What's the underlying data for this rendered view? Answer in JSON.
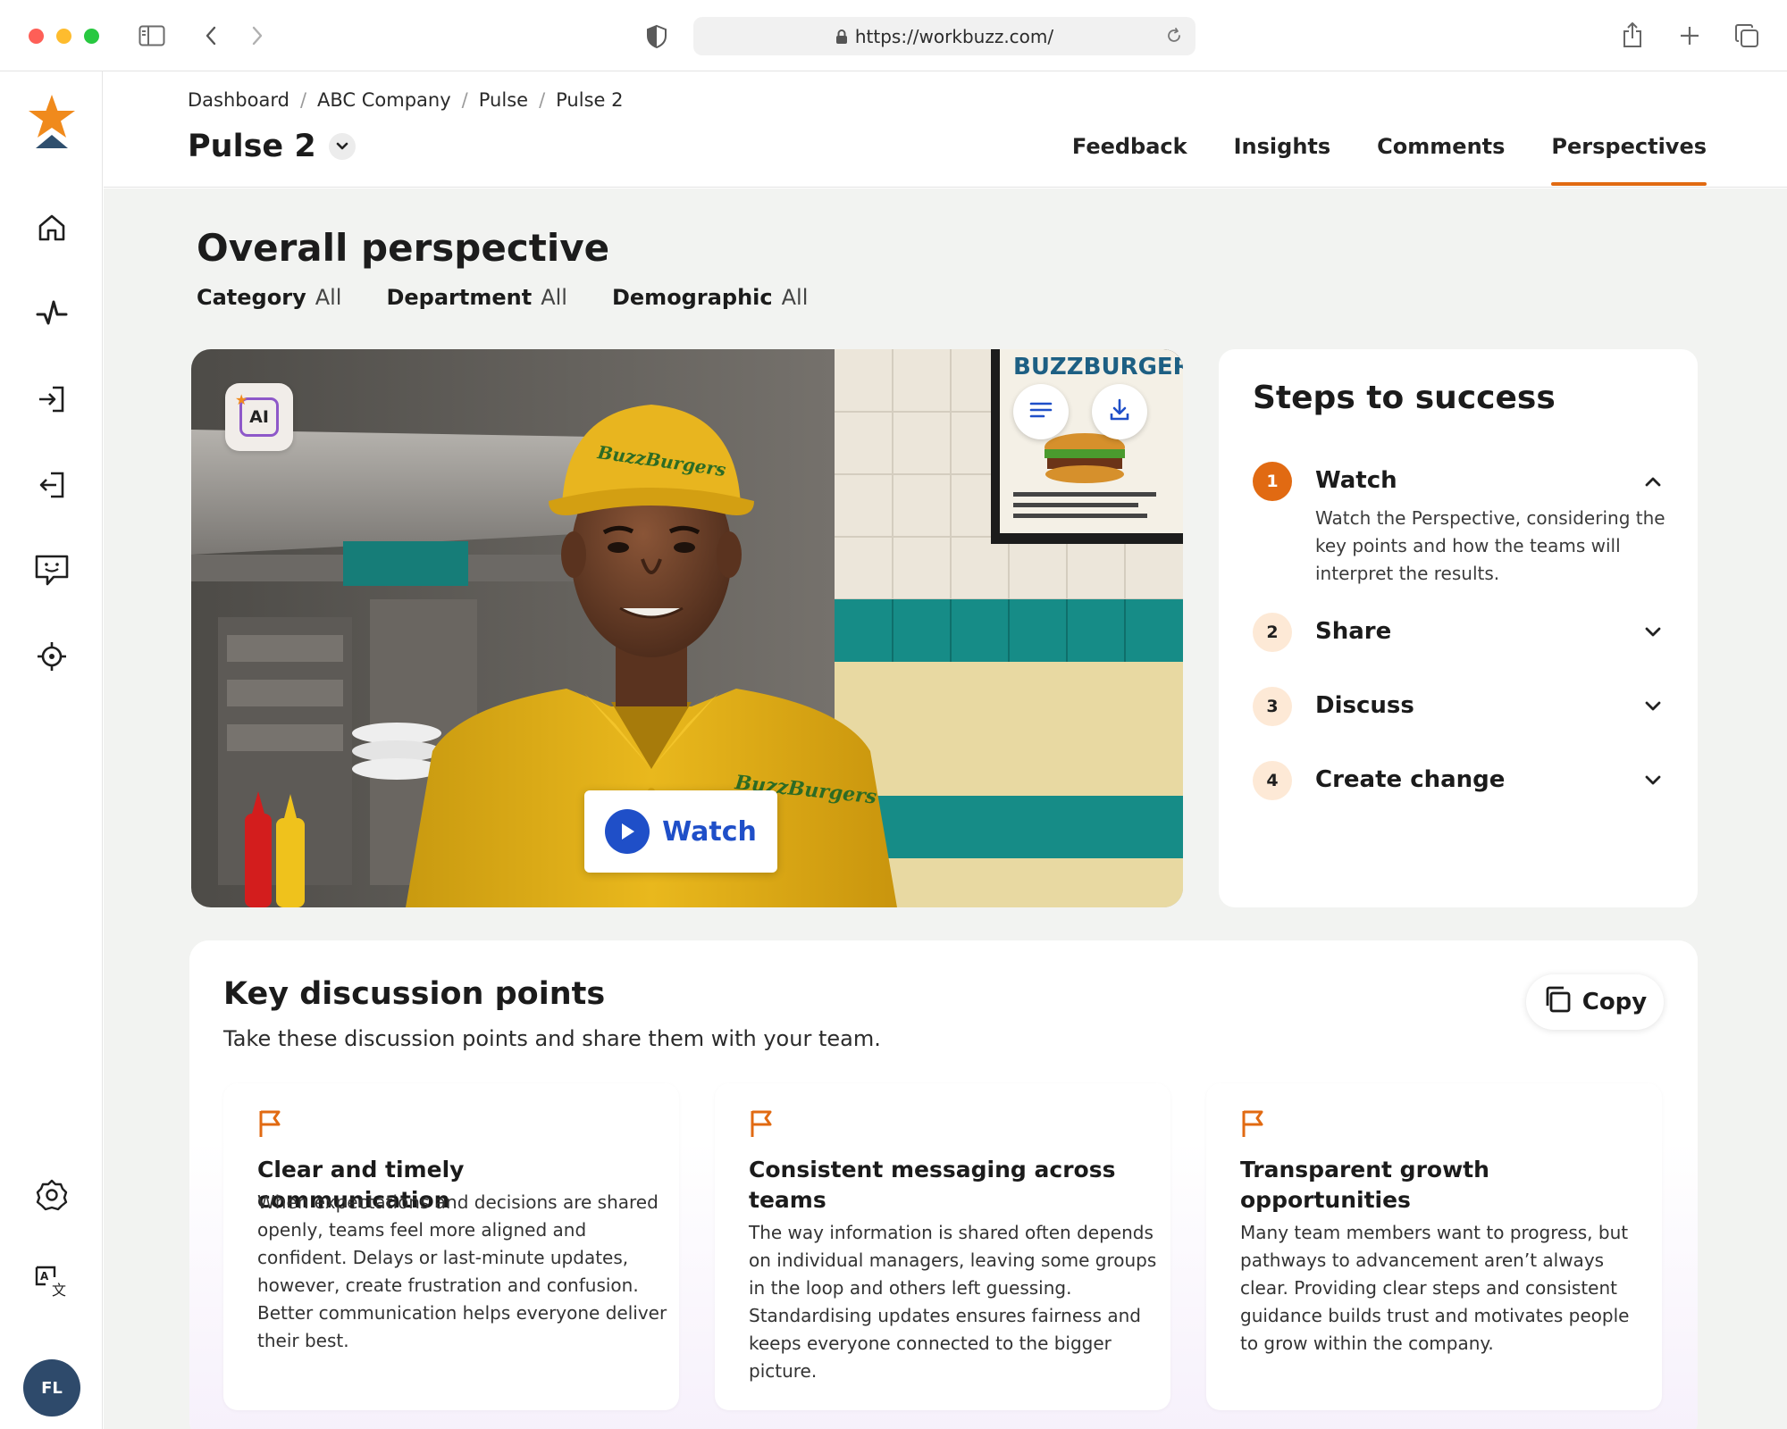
{
  "browser": {
    "url": "https://workbuzz.com/"
  },
  "sidebar": {
    "items": [
      {
        "name": "home-icon"
      },
      {
        "name": "pulse-icon"
      },
      {
        "name": "login-icon"
      },
      {
        "name": "logout-icon"
      },
      {
        "name": "feedback-icon"
      },
      {
        "name": "target-icon"
      }
    ],
    "bottom_items": [
      {
        "name": "settings-icon"
      },
      {
        "name": "translate-icon"
      }
    ],
    "avatar_initials": "FL"
  },
  "header": {
    "breadcrumb": [
      "Dashboard",
      "ABC Company",
      "Pulse",
      "Pulse 2"
    ],
    "breadcrumb_separator": "/",
    "title": "Pulse 2",
    "tabs": [
      {
        "label": "Feedback",
        "active": false
      },
      {
        "label": "Insights",
        "active": false
      },
      {
        "label": "Comments",
        "active": false
      },
      {
        "label": "Perspectives",
        "active": true
      }
    ]
  },
  "main": {
    "title": "Overall perspective",
    "filters": [
      {
        "key": "Category",
        "value": "All"
      },
      {
        "key": "Department",
        "value": "All"
      },
      {
        "key": "Demographic",
        "value": "All"
      }
    ],
    "video": {
      "ai_badge": "AI",
      "cap_text": "BuzzBurgers",
      "shirt_text": "BuzzBurgers",
      "sign_text": "BUZZBURGERS",
      "watch_label": "Watch"
    },
    "steps": {
      "title": "Steps to success",
      "items": [
        {
          "num": "1",
          "label": "Watch",
          "expanded": true,
          "desc": "Watch the Perspective, considering the key points and how the teams will interpret the results."
        },
        {
          "num": "2",
          "label": "Share",
          "expanded": false
        },
        {
          "num": "3",
          "label": "Discuss",
          "expanded": false
        },
        {
          "num": "4",
          "label": "Create change",
          "expanded": false
        }
      ]
    },
    "discussion": {
      "title": "Key discussion points",
      "subtitle": "Take these discussion points and share them with your team.",
      "copy_label": "Copy",
      "points": [
        {
          "title": "Clear and timely communication",
          "body": "When expectations and decisions are shared openly, teams feel more aligned and confident. Delays or last-minute updates, however, create frustration and confusion. Better communication helps everyone deliver their best."
        },
        {
          "title": "Consistent messaging across teams",
          "body": "The way information is shared often depends on individual managers, leaving some groups in the loop and others left guessing. Standardising updates ensures fairness and keeps everyone connected to the bigger picture."
        },
        {
          "title": "Transparent growth opportunities",
          "body": "Many team members want to progress, but pathways to advancement aren’t always clear. Providing clear steps and consistent guidance builds trust and motivates people to grow within the company."
        }
      ]
    }
  },
  "colors": {
    "accent": "#e16a12",
    "primary_blue": "#1f4fc8",
    "avatar_bg": "#2e4a6b",
    "page_bg": "#f2f3f1"
  }
}
